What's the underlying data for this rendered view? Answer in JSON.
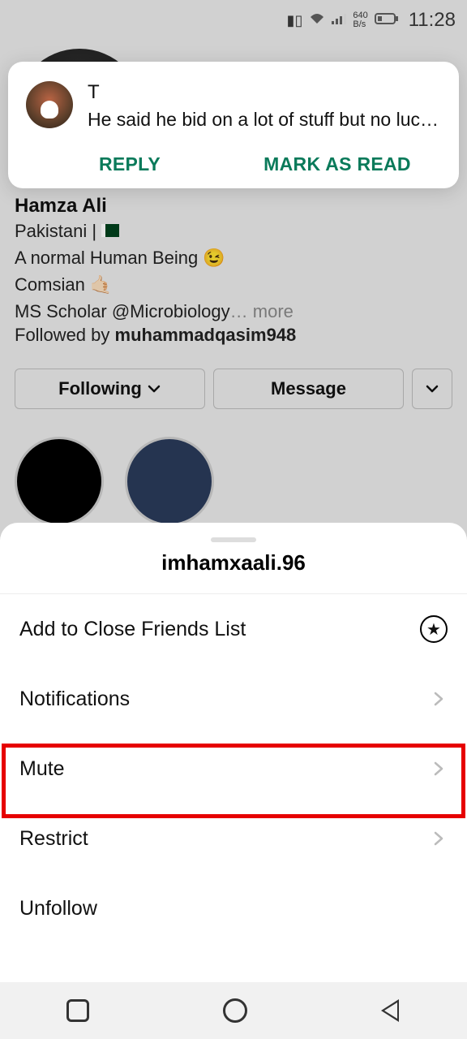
{
  "status": {
    "net_top": "640",
    "net_bottom": "B/s",
    "time": "11:28"
  },
  "profile": {
    "name": "Hamza Ali",
    "bio1_pre": "Pakistani | ",
    "bio2": "A normal Human Being 😉",
    "bio3": "Comsian 🤙🏻",
    "bio4_pre": "MS Scholar @Microbiology",
    "bio4_ell": "…",
    "more": " more",
    "followed_pre": "Followed by ",
    "followed_user": "muhammadqasim948",
    "following_label": "Following",
    "message_label": "Message"
  },
  "notification": {
    "sender": "T",
    "message": "He said he bid on a lot of stuff but no luck …",
    "reply": "REPLY",
    "mark_read": "MARK AS READ"
  },
  "sheet": {
    "title": "imhamxaali.96",
    "items": {
      "close_friends": "Add to Close Friends List",
      "notifications": "Notifications",
      "mute": "Mute",
      "restrict": "Restrict",
      "unfollow": "Unfollow"
    }
  }
}
